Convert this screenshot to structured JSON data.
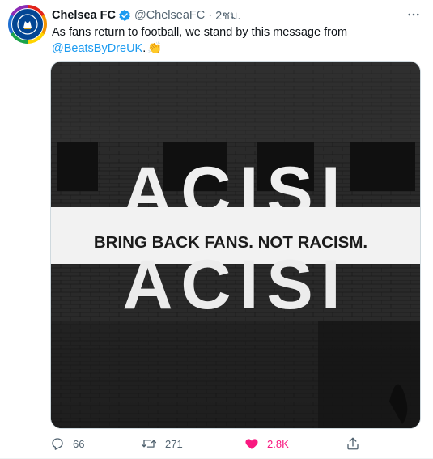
{
  "tweet": {
    "author_name": "Chelsea FC",
    "handle": "@ChelseaFC",
    "separator": "·",
    "time": "2ชม.",
    "text_before": "As fans return to football, we stand by this message from ",
    "mention": "@BeatsByDreUK",
    "text_after": ".",
    "emoji": "👏",
    "media": {
      "banner_text": "BRING BACK FANS. NOT RACISM.",
      "wall_letters": "ACISI"
    },
    "stats": {
      "replies": "66",
      "retweets": "271",
      "likes": "2.8K"
    },
    "colors": {
      "accent": "#1d9bf0",
      "like": "#f91880",
      "muted": "#536471",
      "club_blue": "#034694"
    },
    "icons": {
      "verified": "verified-badge-icon",
      "more": "more-horizontal-icon",
      "reply": "reply-icon",
      "retweet": "retweet-icon",
      "like": "heart-filled-icon",
      "share": "share-icon"
    }
  }
}
